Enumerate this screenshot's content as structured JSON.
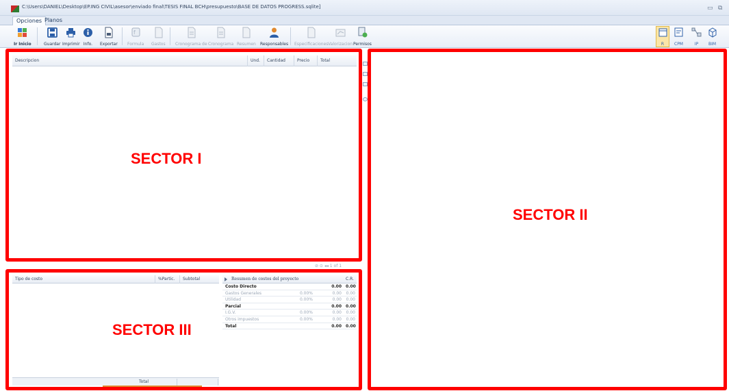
{
  "window": {
    "title_path": "C:\\Users\\DANIEL\\Desktop\\EP.ING CIVIL\\asesor\\enviado final\\TESIS FINAL BCH\\presupuesto\\BASE DE DATOS PROGRESS.sqlite]"
  },
  "tabs": [
    {
      "label": "Opciones"
    },
    {
      "label": "Planos"
    }
  ],
  "ribbon": {
    "ir_inicio": "Ir Inicio",
    "guardar": "Guardar",
    "imprimir": "Imprimir",
    "info": "Info.",
    "exportar": "Exportar",
    "formula": "Formula",
    "gastos": "Gastos",
    "cronograma_de": "Cronograma de",
    "cronograma": "Cronograma",
    "resumen": "Resumen",
    "responsables": "Responsables",
    "especificaciones": "Especificaciones",
    "valorizacion": "Valorizacion",
    "permisos": "Permisos",
    "view_r": "R",
    "view_cpm": "CPM",
    "view_ip": "IP",
    "view_bim": "BIM"
  },
  "budget_table": {
    "columns": [
      "Descripcion",
      "Und.",
      "Cantidad",
      "Precio",
      "Total"
    ],
    "pager": "⊘ ⊙ ◂◂   1 of 1"
  },
  "cost_table": {
    "columns": [
      "Tipo de costo",
      "%Partic.",
      "Subtotal"
    ],
    "footer_total": "Total"
  },
  "resumen": {
    "title": "Resumen de costos del proyecto",
    "cr_header": "C.R.",
    "rows": [
      {
        "label": "Costo Directo",
        "pct": "",
        "amount": "0.00",
        "cr": "0.00",
        "style": "bold"
      },
      {
        "label": "Gastos Generales",
        "pct": "0.00%",
        "amount": "0.00",
        "cr": "0.00",
        "style": "muted"
      },
      {
        "label": "Utilidad",
        "pct": "0.00%",
        "amount": "0.00",
        "cr": "0.00",
        "style": "muted"
      },
      {
        "label": "Parcial",
        "pct": "",
        "amount": "0.00",
        "cr": "0.00",
        "style": "bold"
      },
      {
        "label": "I.G.V.",
        "pct": "0.00%",
        "amount": "0.00",
        "cr": "0.00",
        "style": "muted"
      },
      {
        "label": "Otros impuestos",
        "pct": "0.00%",
        "amount": "0.00",
        "cr": "0.00",
        "style": "muted"
      },
      {
        "label": "Total",
        "pct": "",
        "amount": "0.00",
        "cr": "0.00",
        "style": "bold"
      }
    ]
  },
  "sectors": {
    "s1": "SECTOR I",
    "s2": "SECTOR II",
    "s3": "SECTOR III"
  },
  "colors": {
    "annotation": "#ff0000",
    "ribbon_bg": "#e8eef7",
    "accent": "#e0892f"
  }
}
